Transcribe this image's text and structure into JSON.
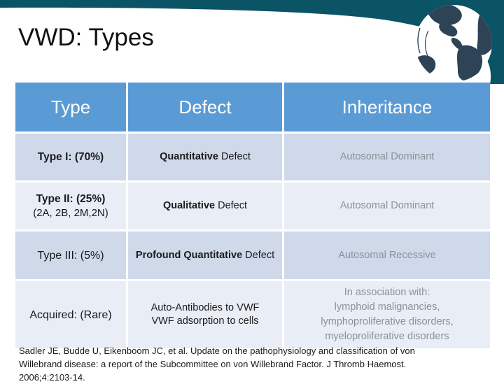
{
  "header": {
    "banner_color": "#0A5466",
    "globe_icon": "globe-icon",
    "globe_land_color": "#2E4356"
  },
  "slide": {
    "title": "VWD: Types"
  },
  "table": {
    "header_bg": "#5B9BD5",
    "header_text_color": "#FFFFFF",
    "row_color_a": "#CFD9EA",
    "row_color_b": "#E9EDF5",
    "inheritance_text_color": "#8C9199",
    "columns": [
      "Type",
      "Defect",
      "Inheritance"
    ],
    "rows": [
      {
        "type_main": "Type I: (70%)",
        "type_sub": "",
        "defect_bold": "Quantitative",
        "defect_rest": " Defect",
        "inheritance": "Autosomal Dominant"
      },
      {
        "type_main": "Type II: (25%)",
        "type_sub": "(2A, 2B, 2M,2N)",
        "defect_bold": "Qualitative",
        "defect_rest": " Defect",
        "inheritance": "Autosomal Dominant"
      },
      {
        "type_main": "Type III: (5%)",
        "type_sub": "",
        "defect_bold": "Profound Quantitative",
        "defect_rest": " Defect",
        "inheritance": "Autosomal Recessive"
      },
      {
        "type_main": "Acquired: (Rare)",
        "type_sub": "",
        "defect_line1": "Auto-Antibodies to VWF",
        "defect_line2": "VWF adsorption to cells",
        "inheritance_line1": "In association with:",
        "inheritance_line2": "lymphoid malignancies,",
        "inheritance_line3": "lymphoproliferative disorders,",
        "inheritance_line4": "myeloproliferative disorders"
      }
    ]
  },
  "citation": {
    "line1": "Sadler JE, Budde U, Eikenboom JC, et al. Update on the pathophysiology and classification of von",
    "line2": "Willebrand disease: a report of the Subcommittee on von Willebrand Factor. J Thromb Haemost.",
    "line3": "2006;4:2103-14."
  }
}
